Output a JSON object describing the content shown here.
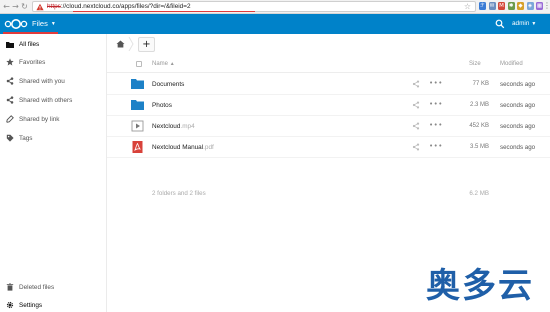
{
  "browser": {
    "url": "https://cloud.nextcloud.co/apps/files/?dir=/&fileid=2",
    "url_protocol": "https",
    "url_rest": "://cloud.nextcloud.co/apps/files/?dir=/&fileid=2",
    "extensions": [
      {
        "name": "bookmark-icon",
        "color": "#3a7bd5"
      },
      {
        "name": "mail-icon",
        "color": "#6c8ebf"
      },
      {
        "name": "gmail-icon",
        "color": "#d44638"
      },
      {
        "name": "puzzle-icon",
        "color": "#6b9a4a"
      },
      {
        "name": "shield-icon",
        "color": "#d6a12a"
      },
      {
        "name": "dropbox-icon",
        "color": "#7aa7d9"
      },
      {
        "name": "grid-icon",
        "color": "#9a6ad6"
      }
    ]
  },
  "header": {
    "app_name": "Files",
    "user": "admin",
    "brand_color": "#0082c9"
  },
  "sidebar": {
    "items": [
      {
        "label": "All files",
        "icon": "folder-icon",
        "active": true
      },
      {
        "label": "Favorites",
        "icon": "star-icon",
        "active": false
      },
      {
        "label": "Shared with you",
        "icon": "share-icon",
        "active": false
      },
      {
        "label": "Shared with others",
        "icon": "share-icon",
        "active": false
      },
      {
        "label": "Shared by link",
        "icon": "link-icon",
        "active": false
      },
      {
        "label": "Tags",
        "icon": "tag-icon",
        "active": false
      }
    ],
    "bottom": [
      {
        "label": "Deleted files",
        "icon": "trash-icon"
      },
      {
        "label": "Settings",
        "icon": "gear-icon"
      }
    ]
  },
  "table": {
    "columns": {
      "name": "Name",
      "size": "Size",
      "modified": "Modified"
    },
    "rows": [
      {
        "name": "Documents",
        "ext": "",
        "type": "folder",
        "size": "77 KB",
        "modified": "seconds ago"
      },
      {
        "name": "Photos",
        "ext": "",
        "type": "folder",
        "size": "2.3 MB",
        "modified": "seconds ago"
      },
      {
        "name": "Nextcloud",
        "ext": ".mp4",
        "type": "video",
        "size": "452 KB",
        "modified": "seconds ago"
      },
      {
        "name": "Nextcloud Manual",
        "ext": ".pdf",
        "type": "pdf",
        "size": "3.5 MB",
        "modified": "seconds ago"
      }
    ],
    "summary": "2 folders and 2 files",
    "summary_size": "6.2 MB"
  },
  "watermark": "奥多云"
}
